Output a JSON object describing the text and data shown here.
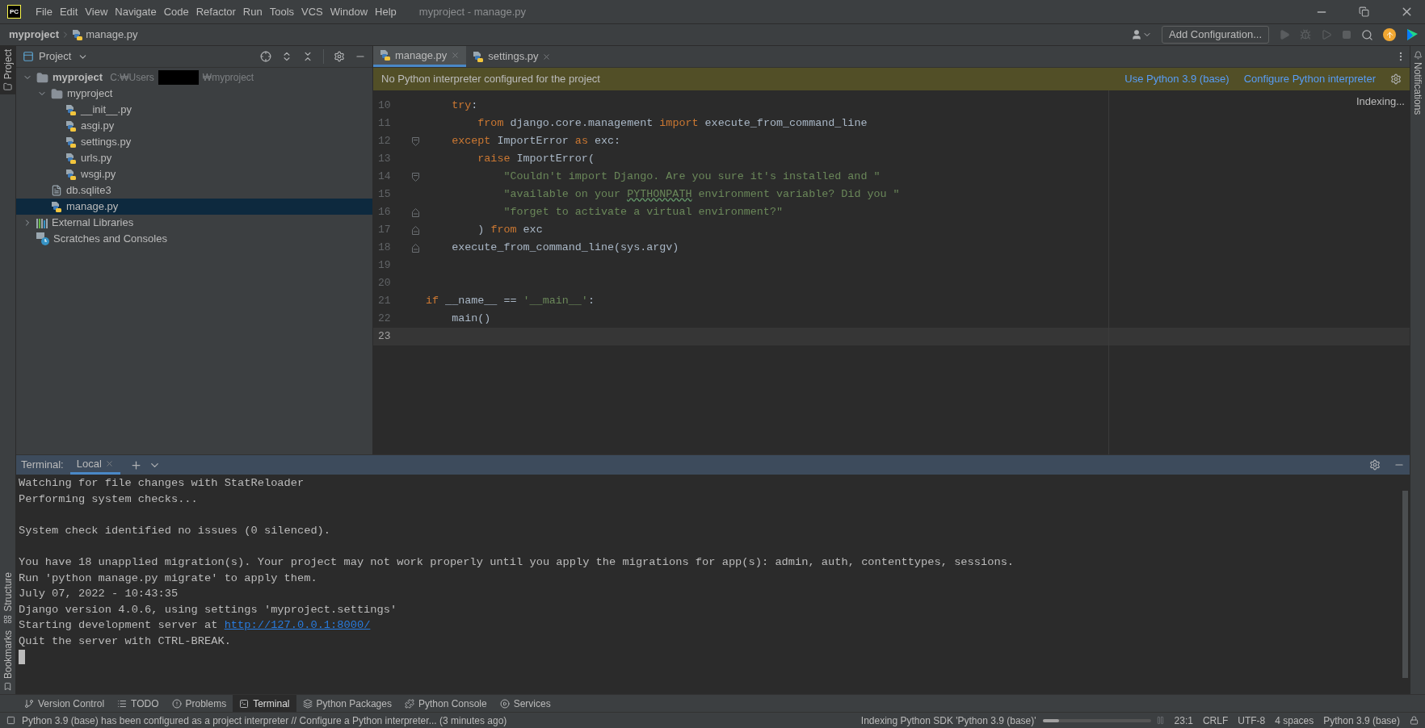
{
  "window": {
    "logo": "PC",
    "menu": [
      "File",
      "Edit",
      "View",
      "Navigate",
      "Code",
      "Refactor",
      "Run",
      "Tools",
      "VCS",
      "Window",
      "Help"
    ],
    "title": "myproject - manage.py"
  },
  "breadcrumb": [
    "myproject",
    "manage.py"
  ],
  "toolbar": {
    "add_configuration": "Add Configuration..."
  },
  "left_strip": [
    {
      "label": "Project",
      "selected": true,
      "kind": "project"
    },
    {
      "label": "Structure",
      "selected": false,
      "kind": "structure"
    },
    {
      "label": "Bookmarks",
      "selected": false,
      "kind": "bookmarks"
    }
  ],
  "project_panel": {
    "title": "Project",
    "tree": [
      {
        "name": "myproject",
        "kind": "root",
        "path_start": "C:₩Users",
        "path_end": "₩myproject",
        "expanded": true,
        "selected": false,
        "children": [
          {
            "name": "myproject",
            "kind": "package",
            "expanded": true,
            "selected": false,
            "children": [
              {
                "name": "__init__.py",
                "kind": "python",
                "selected": false
              },
              {
                "name": "asgi.py",
                "kind": "python",
                "selected": false
              },
              {
                "name": "settings.py",
                "kind": "python",
                "selected": false
              },
              {
                "name": "urls.py",
                "kind": "python",
                "selected": false
              },
              {
                "name": "wsgi.py",
                "kind": "python",
                "selected": false
              }
            ]
          },
          {
            "name": "db.sqlite3",
            "kind": "file",
            "selected": false
          },
          {
            "name": "manage.py",
            "kind": "python",
            "selected": true
          }
        ]
      },
      {
        "name": "External Libraries",
        "kind": "libraries",
        "expanded": false,
        "selected": false
      },
      {
        "name": "Scratches and Consoles",
        "kind": "scratches",
        "selected": false
      }
    ]
  },
  "editor": {
    "tabs": [
      {
        "label": "manage.py",
        "selected": true
      },
      {
        "label": "settings.py",
        "selected": false
      }
    ],
    "banner": {
      "message": "No Python interpreter configured for the project",
      "actions": [
        "Use Python 3.9 (base)",
        "Configure Python interpreter"
      ]
    },
    "status": "Indexing...",
    "lines": [
      {
        "number": "10",
        "kind": "plain",
        "current": false,
        "tokens": [
          {
            "kind": "keyword",
            "text": "    try"
          },
          {
            "kind": "plain",
            "text": ":"
          }
        ]
      },
      {
        "number": "11",
        "kind": "plain",
        "current": false,
        "tokens": [
          {
            "kind": "keyword",
            "text": "        from "
          },
          {
            "kind": "plain",
            "text": "django.core.management "
          },
          {
            "kind": "keyword",
            "text": "import "
          },
          {
            "kind": "plain",
            "text": "execute_from_command_line"
          }
        ]
      },
      {
        "number": "12",
        "kind": "fold_start",
        "current": false,
        "tokens": [
          {
            "kind": "keyword",
            "text": "    except "
          },
          {
            "kind": "plain",
            "text": "ImportError "
          },
          {
            "kind": "keyword",
            "text": "as "
          },
          {
            "kind": "plain",
            "text": "exc:"
          }
        ]
      },
      {
        "number": "13",
        "kind": "plain",
        "current": false,
        "tokens": [
          {
            "kind": "keyword",
            "text": "        raise "
          },
          {
            "kind": "plain",
            "text": "ImportError("
          }
        ]
      },
      {
        "number": "14",
        "kind": "fold_start",
        "current": false,
        "tokens": [
          {
            "kind": "string",
            "text": "            \"Couldn't import Django. Are you sure it's installed and \""
          }
        ]
      },
      {
        "number": "15",
        "kind": "plain",
        "current": false,
        "tokens": [
          {
            "kind": "string",
            "text": "            \"available on your "
          },
          {
            "kind": "typo",
            "text": "PYTHONPATH"
          },
          {
            "kind": "string",
            "text": " environment variable? Did you \""
          }
        ]
      },
      {
        "number": "16",
        "kind": "fold_end",
        "current": false,
        "tokens": [
          {
            "kind": "string",
            "text": "            \"forget to activate a virtual environment?\""
          }
        ]
      },
      {
        "number": "17",
        "kind": "fold_end",
        "current": false,
        "tokens": [
          {
            "kind": "plain",
            "text": "        ) "
          },
          {
            "kind": "keyword",
            "text": "from "
          },
          {
            "kind": "plain",
            "text": "exc"
          }
        ]
      },
      {
        "number": "18",
        "kind": "fold_end",
        "current": false,
        "tokens": [
          {
            "kind": "plain",
            "text": "    execute_from_command_line(sys.argv)"
          }
        ]
      },
      {
        "number": "19",
        "kind": "plain",
        "current": false
      },
      {
        "number": "20",
        "kind": "plain",
        "current": false
      },
      {
        "number": "21",
        "kind": "plain",
        "current": false,
        "tokens": [
          {
            "kind": "keyword",
            "text": "if "
          },
          {
            "kind": "plain",
            "text": "__name__ == "
          },
          {
            "kind": "string",
            "text": "'__main__'"
          },
          {
            "kind": "plain",
            "text": ":"
          }
        ]
      },
      {
        "number": "22",
        "kind": "plain",
        "current": false,
        "tokens": [
          {
            "kind": "plain",
            "text": "    main()"
          }
        ]
      },
      {
        "number": "23",
        "kind": "plain",
        "current": true
      }
    ]
  },
  "terminal": {
    "label": "Terminal:",
    "tabs": [
      {
        "label": "Local",
        "selected": true
      }
    ],
    "lines": [
      {
        "kind": "text",
        "text": "Watching for file changes with StatReloader"
      },
      {
        "kind": "text",
        "text": "Performing system checks..."
      },
      {
        "kind": "blank"
      },
      {
        "kind": "text",
        "text": "System check identified no issues (0 silenced)."
      },
      {
        "kind": "blank"
      },
      {
        "kind": "text",
        "text": "You have 18 unapplied migration(s). Your project may not work properly until you apply the migrations for app(s): admin, auth, contenttypes, sessions."
      },
      {
        "kind": "text",
        "text": "Run 'python manage.py migrate' to apply them."
      },
      {
        "kind": "text",
        "text": "July 07, 2022 - 10:43:35"
      },
      {
        "kind": "text",
        "text": "Django version 4.0.6, using settings 'myproject.settings'"
      },
      {
        "kind": "link",
        "text": "Starting development server at ",
        "link": "http://127.0.0.1:8000/"
      },
      {
        "kind": "text",
        "text": "Quit the server with CTRL-BREAK."
      }
    ]
  },
  "tool_tabs": [
    {
      "label": "Version Control",
      "kind": "vcs",
      "selected": false
    },
    {
      "label": "TODO",
      "kind": "todo",
      "selected": false
    },
    {
      "label": "Problems",
      "kind": "problems",
      "selected": false
    },
    {
      "label": "Terminal",
      "kind": "terminal",
      "selected": true
    },
    {
      "label": "Python Packages",
      "kind": "packages",
      "selected": false
    },
    {
      "label": "Python Console",
      "kind": "console",
      "selected": false
    },
    {
      "label": "Services",
      "kind": "services",
      "selected": false
    }
  ],
  "right_strip": [
    {
      "label": "Notifications"
    }
  ],
  "status_bar": {
    "message": "Python 3.9 (base) has been configured as a project interpreter // Configure a Python interpreter... (3 minutes ago)",
    "task": "Indexing Python SDK 'Python 3.9 (base)'",
    "level": 0.15,
    "items": [
      "23:1",
      "CRLF",
      "UTF-8",
      "4 spaces",
      "Python 3.9 (base)"
    ]
  }
}
